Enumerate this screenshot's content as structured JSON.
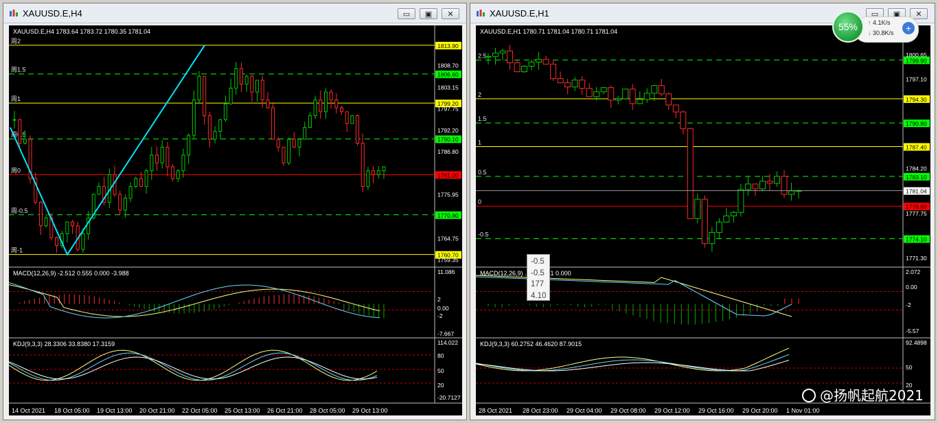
{
  "left_window": {
    "title": "XAUUSD.E,H4",
    "header": "XAUUSD.E,H4  1783.64 1783.72 1780.35 1781.04",
    "fib_levels": [
      {
        "label": "周2",
        "price": "1813.90",
        "color": "#ffff00",
        "value": 1813.9
      },
      {
        "label": "周1.5",
        "price": "1806.60",
        "color": "#00ff00",
        "value": 1806.6
      },
      {
        "label": "周1",
        "price": "1799.20",
        "color": "#ffff00",
        "value": 1799.2
      },
      {
        "label": "周0.5",
        "price": "1790.10",
        "color": "#00ff00",
        "value": 1790.1
      },
      {
        "label": "周0",
        "price": "1781.00",
        "color": "#ff0000",
        "value": 1781.0
      },
      {
        "label": "周-0.5",
        "price": "1770.80",
        "color": "#00ff00",
        "value": 1770.8
      },
      {
        "label": "周-1",
        "price": "1760.70",
        "color": "#ffff00",
        "value": 1760.7
      }
    ],
    "price_ticks": [
      "1808.70",
      "1803.15",
      "1797.75",
      "1792.20",
      "1786.80",
      "1775.95",
      "1764.75",
      "1759.35"
    ],
    "macd_label": "MACD(12,26,9) -2.512 0.555 0.000 -3.988",
    "macd_ticks": [
      "11.086",
      "2",
      "0.00",
      "-2",
      "-7.667"
    ],
    "kdj_label": "KDJ(9,3,3) 28.3306 33.8380 17.3159",
    "kdj_ticks": [
      "114.022",
      "80",
      "50",
      "20",
      "-20.7127"
    ],
    "time_labels": [
      "14 Oct 2021",
      "18 Oct 05:00",
      "19 Oct 13:00",
      "20 Oct 21:00",
      "22 Oct 05:00",
      "25 Oct 13:00",
      "26 Oct 21:00",
      "28 Oct 05:00",
      "29 Oct 13:00"
    ]
  },
  "right_window": {
    "title": "XAUUSD.E,H1",
    "header": "XAUUSD.E,H1  1780.71 1781.04 1780.71 1781.04",
    "fib_levels": [
      {
        "label": "2.5",
        "price": "1799.90",
        "color": "#00ff00",
        "value": 1799.9
      },
      {
        "label": "2",
        "price": "1794.30",
        "color": "#ffff00",
        "value": 1794.3
      },
      {
        "label": "1.5",
        "price": "1790.80",
        "color": "#00ff00",
        "value": 1790.8
      },
      {
        "label": "1",
        "price": "1787.40",
        "color": "#ffff00",
        "value": 1787.4
      },
      {
        "label": "0.5",
        "price": "1783.10",
        "color": "#00ff00",
        "value": 1783.1
      },
      {
        "label": "0",
        "price": "1778.80",
        "color": "#ff0000",
        "value": 1778.8
      },
      {
        "label": "-0.5",
        "price": "1774.10",
        "color": "#00ff00",
        "value": 1774.1
      }
    ],
    "current_price": "1781.04",
    "price_ticks": [
      "1800.65",
      "1797.10",
      "1784.20",
      "1777.75",
      "1771.30"
    ],
    "macd_label": "MACD(12,26,9) ",
    "macd_value_tail": ".742 0.571 0.000",
    "macd_ticks": [
      "2.072",
      "0.00",
      "-2",
      "-5.57"
    ],
    "kdj_label": "KDJ(9,3,3) 60.2752 46.4620 87.9015",
    "kdj_ticks": [
      "92.4898",
      "50",
      "20"
    ],
    "time_labels": [
      "28 Oct 2021",
      "28 Oct 23:00",
      "29 Oct 04:00",
      "29 Oct 08:00",
      "29 Oct 12:00",
      "29 Oct 16:00",
      "29 Oct 20:00",
      "1 Nov 01:00"
    ]
  },
  "tooltip": [
    "-0.5",
    "-0.5",
    "177",
    "4.10"
  ],
  "network_widget": {
    "percent": "55%",
    "upload": "4.1K/s",
    "download": "30.8K/s"
  },
  "watermark": "@扬帆起航2021",
  "window_buttons": {
    "minimize": "▭",
    "restore": "▣",
    "close": "✕"
  }
}
